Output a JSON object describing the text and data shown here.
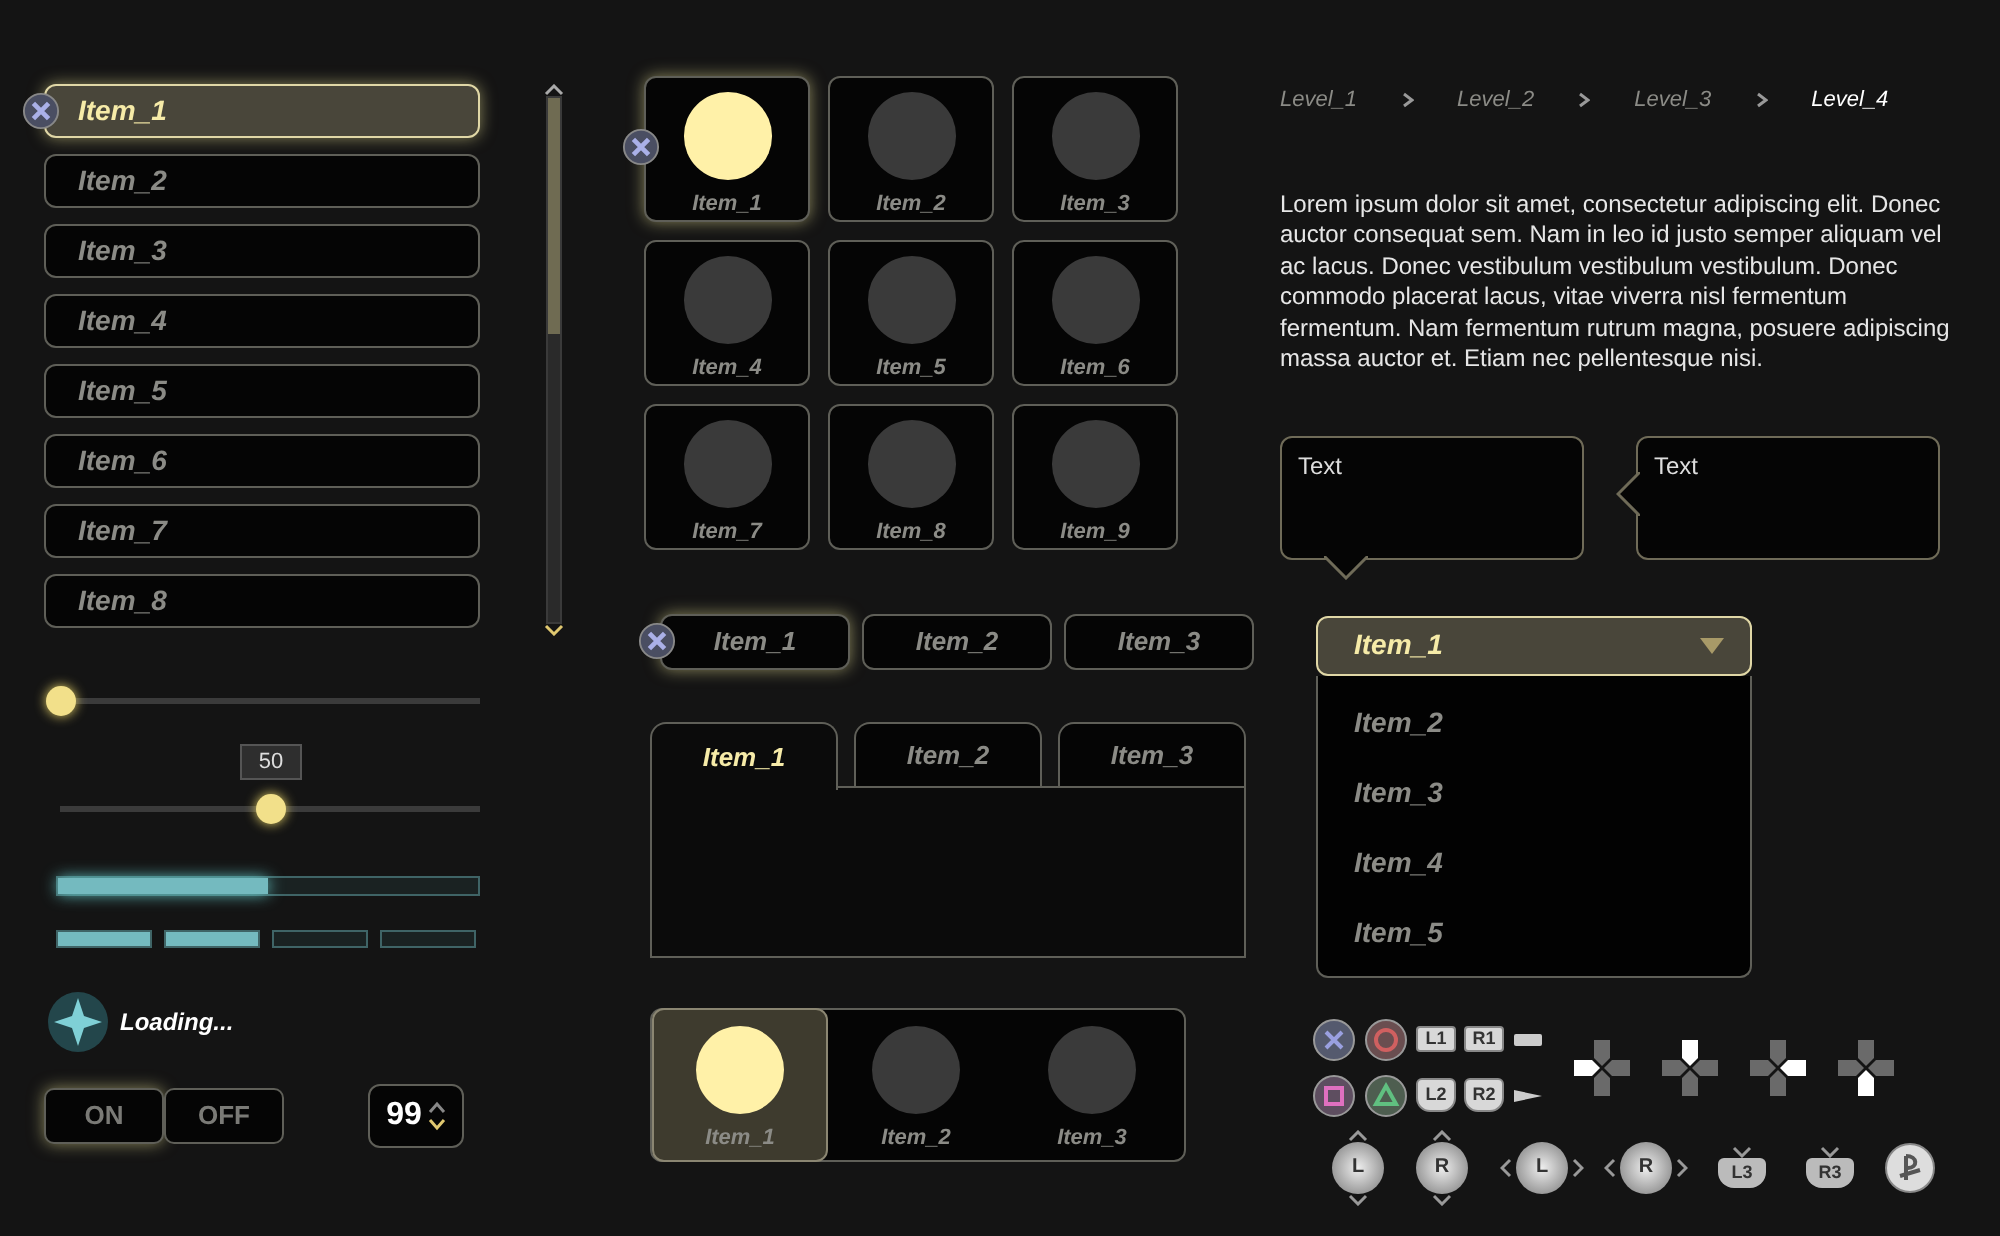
{
  "menu_list": {
    "items": [
      {
        "label": "Item_1",
        "selected": true
      },
      {
        "label": "Item_2",
        "selected": false
      },
      {
        "label": "Item_3",
        "selected": false
      },
      {
        "label": "Item_4",
        "selected": false
      },
      {
        "label": "Item_5",
        "selected": false
      },
      {
        "label": "Item_6",
        "selected": false
      },
      {
        "label": "Item_7",
        "selected": false
      },
      {
        "label": "Item_8",
        "selected": false
      }
    ]
  },
  "sliders": [
    {
      "level": 0
    },
    {
      "level": 0.5,
      "tooltip": "50"
    }
  ],
  "progress": {
    "level": 0.5
  },
  "segmented_progress": {
    "segments": [
      {
        "filled": true
      },
      {
        "filled": true
      },
      {
        "filled": false
      },
      {
        "filled": false
      }
    ]
  },
  "loading": {
    "label": "Loading..."
  },
  "toggle": [
    {
      "label": "ON",
      "selected": true
    },
    {
      "label": "OFF",
      "selected": false
    }
  ],
  "stepper": {
    "value": "99"
  },
  "tile_grid": [
    {
      "label": "Item_1",
      "selected": true
    },
    {
      "label": "Item_2",
      "selected": false
    },
    {
      "label": "Item_3",
      "selected": false
    },
    {
      "label": "Item_4",
      "selected": false
    },
    {
      "label": "Item_5",
      "selected": false
    },
    {
      "label": "Item_6",
      "selected": false
    },
    {
      "label": "Item_7",
      "selected": false
    },
    {
      "label": "Item_8",
      "selected": false
    },
    {
      "label": "Item_9",
      "selected": false
    }
  ],
  "button_row": [
    {
      "label": "Item_1",
      "selected": true
    },
    {
      "label": "Item_2",
      "selected": false
    },
    {
      "label": "Item_3",
      "selected": false
    }
  ],
  "tabs": [
    {
      "label": "Item_1",
      "selected": true
    },
    {
      "label": "Item_2",
      "selected": false
    },
    {
      "label": "Item_3",
      "selected": false
    }
  ],
  "icon_tabs": [
    {
      "label": "Item_1",
      "selected": true
    },
    {
      "label": "Item_2",
      "selected": false
    },
    {
      "label": "Item_3",
      "selected": false
    }
  ],
  "breadcrumb": [
    {
      "label": "Level_1",
      "selected": false
    },
    {
      "label": "Level_2",
      "selected": false
    },
    {
      "label": "Level_3",
      "selected": false
    },
    {
      "label": "Level_4",
      "selected": true
    }
  ],
  "paragraph": "Lorem ipsum dolor sit amet, consectetur adipiscing elit. Donec auctor consequat sem. Nam in leo id justo semper aliquam vel ac lacus. Donec vestibulum vestibulum vestibulum. Donec commodo placerat lacus, vitae viverra nisl fermentum fermentum. Nam fermentum rutrum magna, posuere adipiscing massa auctor et. Etiam nec pellentesque nisi.",
  "bubbles": [
    {
      "text": "Text",
      "kind": "bottom"
    },
    {
      "text": "Text",
      "kind": "left"
    }
  ],
  "dropdown": {
    "value": "Item_1",
    "expanded": true,
    "options": [
      "Item_2",
      "Item_3",
      "Item_4",
      "Item_5"
    ]
  },
  "gamepad": {
    "row_1": [
      {
        "kind": "cross"
      },
      {
        "kind": "circle"
      },
      {
        "kind": "key",
        "label": "L1"
      },
      {
        "kind": "key",
        "label": "R1"
      },
      {
        "kind": "select"
      }
    ],
    "row_2": [
      {
        "kind": "square"
      },
      {
        "kind": "triangle"
      },
      {
        "kind": "trigger",
        "label": "L2"
      },
      {
        "kind": "trigger",
        "label": "R2"
      },
      {
        "kind": "start"
      }
    ],
    "dpads": [
      {
        "kind": "left"
      },
      {
        "kind": "up"
      },
      {
        "kind": "right"
      },
      {
        "kind": "down"
      }
    ],
    "sticks": [
      {
        "kind": "vertical",
        "label": "L"
      },
      {
        "kind": "vertical",
        "label": "R"
      },
      {
        "kind": "horizontal",
        "label": "L"
      },
      {
        "kind": "horizontal",
        "label": "R"
      },
      {
        "kind": "click",
        "label": "L3"
      },
      {
        "kind": "click",
        "label": "R3"
      },
      {
        "kind": "ps"
      }
    ]
  }
}
